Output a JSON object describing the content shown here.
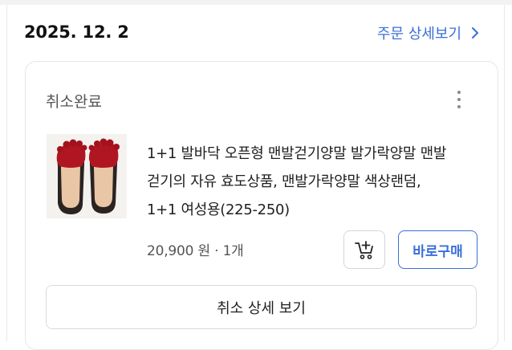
{
  "order": {
    "date": "2025. 12. 2",
    "detail_link_label": "주문 상세보기",
    "detail_link_icon": "chevron-right-icon"
  },
  "card": {
    "status": "취소완료",
    "more_icon": "more-vertical-icon",
    "product": {
      "image_icon": "toe-socks-product-image",
      "name_lines": [
        "1+1 발바닥 오픈형 맨발걷기양말 발가락양말 맨발",
        "걷기의 자유 효도상품, 맨발가락양말 색상랜덤,",
        "1+1 여성용(225-250)"
      ],
      "price": "20,900 원",
      "quantity": "1개"
    },
    "cart_button_icon": "add-to-cart-icon",
    "buy_button_label": "바로구매",
    "cancel_detail_button_label": "취소 상세 보기"
  },
  "colors": {
    "accent": "#3a6fd8",
    "text": "#1f1f1f",
    "muted": "#555555",
    "border": "#d9dbdf"
  }
}
